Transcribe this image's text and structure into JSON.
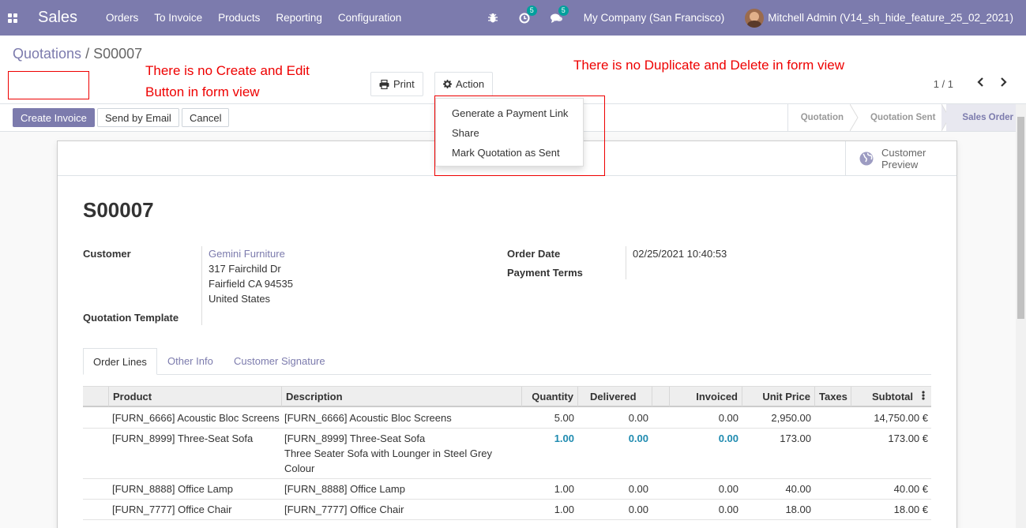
{
  "navbar": {
    "app_name": "Sales",
    "menu": [
      "Orders",
      "To Invoice",
      "Products",
      "Reporting",
      "Configuration"
    ],
    "activity_count": "5",
    "message_count": "5",
    "company": "My Company (San Francisco)",
    "user": "Mitchell Admin (V14_sh_hide_feature_25_02_2021)"
  },
  "breadcrumb": {
    "parent": "Quotations",
    "separator": " / ",
    "current": "S00007"
  },
  "annotations": {
    "left_line1": "There is no Create and Edit",
    "left_line2": "Button in form view",
    "right": "There is no Duplicate and Delete in form view"
  },
  "toolbar": {
    "print_label": "Print",
    "action_label": "Action"
  },
  "action_menu": [
    "Generate a Payment Link",
    "Share",
    "Mark Quotation as Sent"
  ],
  "pager": {
    "value": "1 / 1"
  },
  "statusbar": {
    "create_invoice": "Create Invoice",
    "send_by_email": "Send by Email",
    "cancel": "Cancel",
    "stages": [
      "Quotation",
      "Quotation Sent",
      "Sales Order"
    ],
    "active_stage": "Sales Order"
  },
  "sheet": {
    "customer_preview_line1": "Customer",
    "customer_preview_line2": "Preview",
    "title": "S00007",
    "customer_label": "Customer",
    "customer_name": "Gemini Furniture",
    "customer_address": [
      "317 Fairchild Dr",
      "Fairfield CA 94535",
      "United States"
    ],
    "quotation_template_label": "Quotation Template",
    "order_date_label": "Order Date",
    "order_date": "02/25/2021 10:40:53",
    "payment_terms_label": "Payment Terms"
  },
  "tabs": [
    "Order Lines",
    "Other Info",
    "Customer Signature"
  ],
  "order_lines": {
    "headers": [
      "Product",
      "Description",
      "Quantity",
      "Delivered",
      "Invoiced",
      "Unit Price",
      "Taxes",
      "Subtotal"
    ],
    "rows": [
      {
        "product": "[FURN_6666] Acoustic Bloc Screens",
        "description": [
          "[FURN_6666] Acoustic Bloc Screens"
        ],
        "quantity": "5.00",
        "delivered": "0.00",
        "invoiced": "0.00",
        "unit_price": "2,950.00",
        "taxes": "",
        "subtotal": "14,750.00 €",
        "highlight": false
      },
      {
        "product": "[FURN_8999] Three-Seat Sofa",
        "description": [
          "[FURN_8999] Three-Seat Sofa",
          "Three Seater Sofa with Lounger in Steel Grey",
          "Colour"
        ],
        "quantity": "1.00",
        "delivered": "0.00",
        "invoiced": "0.00",
        "unit_price": "173.00",
        "taxes": "",
        "subtotal": "173.00 €",
        "highlight": true
      },
      {
        "product": "[FURN_8888] Office Lamp",
        "description": [
          "[FURN_8888] Office Lamp"
        ],
        "quantity": "1.00",
        "delivered": "0.00",
        "invoiced": "0.00",
        "unit_price": "40.00",
        "taxes": "",
        "subtotal": "40.00 €",
        "highlight": false
      },
      {
        "product": "[FURN_7777] Office Chair",
        "description": [
          "[FURN_7777] Office Chair"
        ],
        "quantity": "1.00",
        "delivered": "0.00",
        "invoiced": "0.00",
        "unit_price": "18.00",
        "taxes": "",
        "subtotal": "18.00 €",
        "highlight": false
      }
    ]
  },
  "colors": {
    "brand": "#7c7bad",
    "annotation": "#ee0000",
    "highlight_value": "#1f8bb0"
  }
}
